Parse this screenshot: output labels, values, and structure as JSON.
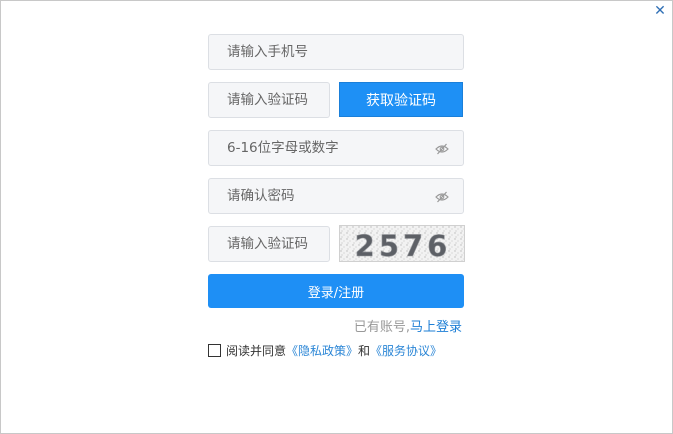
{
  "window": {
    "close_glyph": "✕"
  },
  "form": {
    "phone_placeholder": "请输入手机号",
    "sms_code_placeholder": "请输入验证码",
    "sms_button_label": "获取验证码",
    "password_placeholder": "6-16位字母或数字",
    "confirm_password_placeholder": "请确认密码",
    "captcha_placeholder": "请输入验证码",
    "captcha_text": "2576",
    "submit_label": "登录/注册"
  },
  "login_prompt": {
    "text": "已有账号,",
    "link": "马上登录"
  },
  "agreement": {
    "prefix": "阅读并同意",
    "privacy_link": "《隐私政策》",
    "conjunction": "和",
    "service_link": "《服务协议》"
  },
  "colors": {
    "accent": "#1e90f5",
    "link": "#1e7fd6",
    "field_bg": "#f5f6f8"
  }
}
